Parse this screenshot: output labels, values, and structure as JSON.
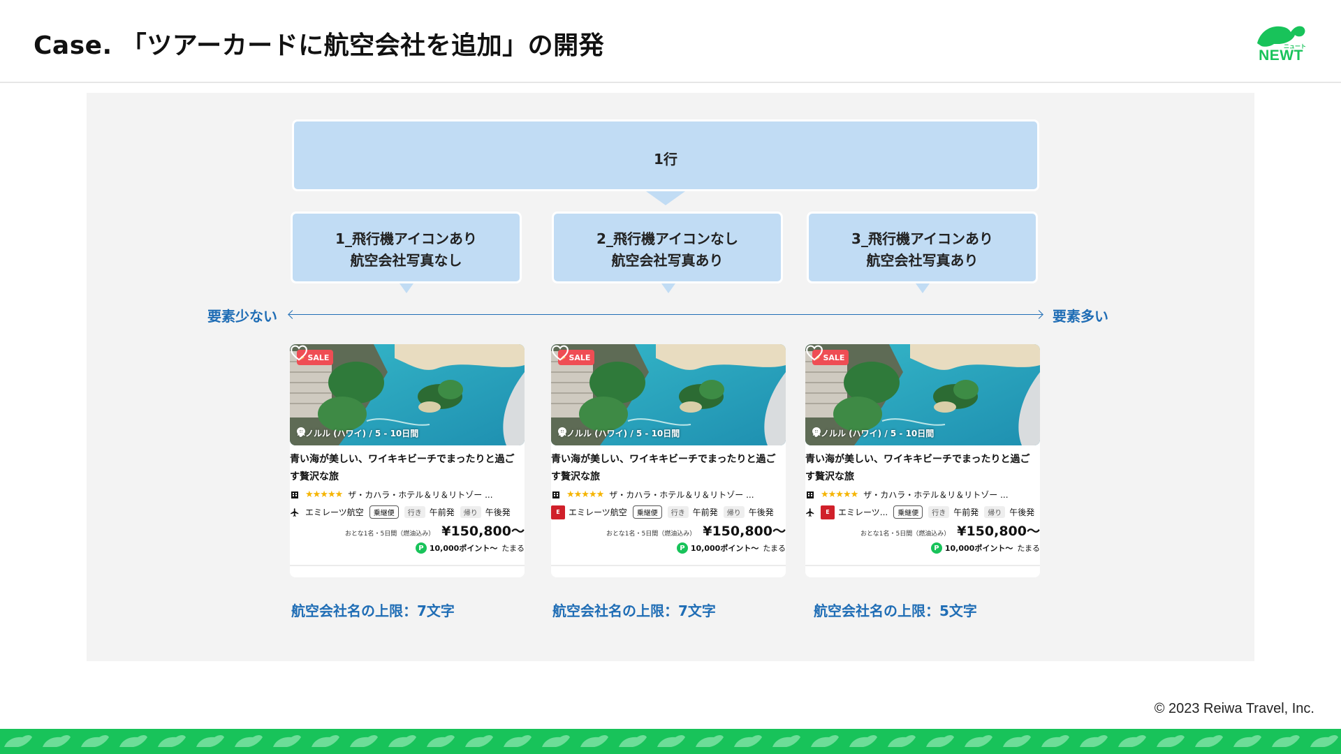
{
  "title": "Case. 「ツアーカードに航空会社を追加」の開発",
  "logo": {
    "text": "NEWT",
    "sub": "ニュート"
  },
  "diagram": {
    "top_label": "1行",
    "options": [
      {
        "line1": "1_飛行機アイコンあり",
        "line2": "航空会社写真なし"
      },
      {
        "line1": "2_飛行機アイコンなし",
        "line2": "航空会社写真あり"
      },
      {
        "line1": "3_飛行機アイコンあり",
        "line2": "航空会社写真あり"
      }
    ],
    "axis_left": "要素少ない",
    "axis_right": "要素多い"
  },
  "cards": [
    {
      "sale": "SALE",
      "location": "ホノルル (ハワイ) / 5 - 10日間",
      "title": "青い海が美しい、ワイキキビーチでまったりと過ごす贅沢な旅",
      "hotel": "ザ・カハラ・ホテル＆リ＆リトゾー ...",
      "airline": "エミレーツ航空",
      "flight_tag": "乗継便",
      "out_label": "行き",
      "out_time": "午前発",
      "ret_label": "帰り",
      "ret_time": "午後発",
      "price_note": "おとな1名・5日間（燃油込み）",
      "price": "¥150,800〜",
      "points": "10,000ポイント〜",
      "points_suffix": "たまる",
      "limit": "航空会社名の上限：7文字",
      "plane_icon": true,
      "airline_logo": false
    },
    {
      "sale": "SALE",
      "location": "ホノルル (ハワイ) / 5 - 10日間",
      "title": "青い海が美しい、ワイキキビーチでまったりと過ごす贅沢な旅",
      "hotel": "ザ・カハラ・ホテル＆リ＆リトゾー ...",
      "airline": "エミレーツ航空",
      "flight_tag": "乗継便",
      "out_label": "行き",
      "out_time": "午前発",
      "ret_label": "帰り",
      "ret_time": "午後発",
      "price_note": "おとな1名・5日間（燃油込み）",
      "price": "¥150,800〜",
      "points": "10,000ポイント〜",
      "points_suffix": "たまる",
      "limit": "航空会社名の上限：7文字",
      "plane_icon": false,
      "airline_logo": true
    },
    {
      "sale": "SALE",
      "location": "ホノルル (ハワイ) / 5 - 10日間",
      "title": "青い海が美しい、ワイキキビーチでまったりと過ごす贅沢な旅",
      "hotel": "ザ・カハラ・ホテル＆リ＆リトゾー ...",
      "airline": "エミレーツ...",
      "flight_tag": "乗継便",
      "out_label": "行き",
      "out_time": "午前発",
      "ret_label": "帰り",
      "ret_time": "午後発",
      "price_note": "おとな1名・5日間（燃油込み）",
      "price": "¥150,800〜",
      "points": "10,000ポイント〜",
      "points_suffix": "たまる",
      "limit": "航空会社名の上限：5文字",
      "plane_icon": true,
      "airline_logo": true
    }
  ],
  "copyright": "© 2023 Reiwa Travel, Inc.",
  "colors": {
    "brand_green": "#18c35a",
    "accent_blue": "#1f6db5",
    "bubble_blue": "#c1dcf4",
    "sale_red": "#ef4d54",
    "star_yellow": "#f5b400"
  },
  "icons": [
    "turtle-logo-icon",
    "lightning-icon",
    "heart-icon",
    "location-pin-icon",
    "hotel-icon",
    "star-icon",
    "plane-icon",
    "airline-logo-icon",
    "points-p-icon"
  ]
}
